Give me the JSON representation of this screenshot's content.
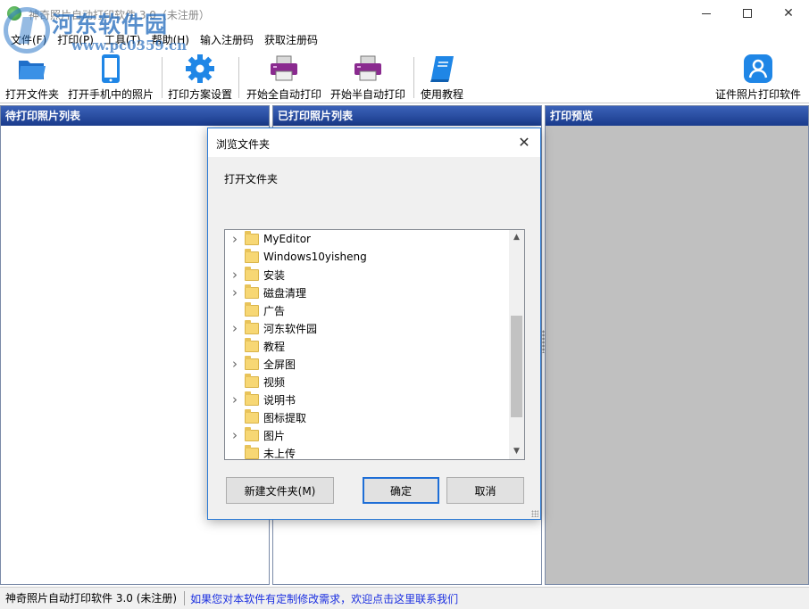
{
  "window": {
    "title": "神奇照片自动打印软件 3.0（未注册）",
    "watermark_text": "河东软件园",
    "watermark_url": "www.pc0359.cn"
  },
  "menu": [
    {
      "label": "文件(F)"
    },
    {
      "label": "打印(P)"
    },
    {
      "label": "工具(T)"
    },
    {
      "label": "帮助(H)"
    },
    {
      "label": "输入注册码"
    },
    {
      "label": "获取注册码"
    }
  ],
  "toolbar": {
    "open_folder": "打开文件夹",
    "open_phone": "打开手机中的照片",
    "print_settings": "打印方案设置",
    "auto_print": "开始全自动打印",
    "semi_auto_print": "开始半自动打印",
    "tutorial": "使用教程",
    "id_photo": "证件照片打印软件"
  },
  "panels": {
    "pending": "待打印照片列表",
    "printed": "已打印照片列表",
    "preview": "打印预览"
  },
  "dialog": {
    "title": "浏览文件夹",
    "description": "打开文件夹",
    "folders": [
      {
        "name": "MyEditor",
        "expandable": true
      },
      {
        "name": "Windows10yisheng",
        "expandable": false
      },
      {
        "name": "安装",
        "expandable": true
      },
      {
        "name": "磁盘清理",
        "expandable": true
      },
      {
        "name": "广告",
        "expandable": false
      },
      {
        "name": "河东软件园",
        "expandable": true
      },
      {
        "name": "教程",
        "expandable": false
      },
      {
        "name": "全屏图",
        "expandable": true
      },
      {
        "name": "视频",
        "expandable": false
      },
      {
        "name": "说明书",
        "expandable": true
      },
      {
        "name": "图标提取",
        "expandable": false
      },
      {
        "name": "图片",
        "expandable": true
      },
      {
        "name": "未上传",
        "expandable": false
      }
    ],
    "new_folder": "新建文件夹(M)",
    "ok": "确定",
    "cancel": "取消"
  },
  "status": {
    "version": "神奇照片自动打印软件 3.0 (未注册)",
    "link": "如果您对本软件有定制修改需求，欢迎点击这里联系我们"
  },
  "colors": {
    "panel_header": "#1a3b8c",
    "link": "#1a2ee0",
    "accent_blue": "#1e6ed6",
    "preview_bg": "#c0c0c0"
  }
}
